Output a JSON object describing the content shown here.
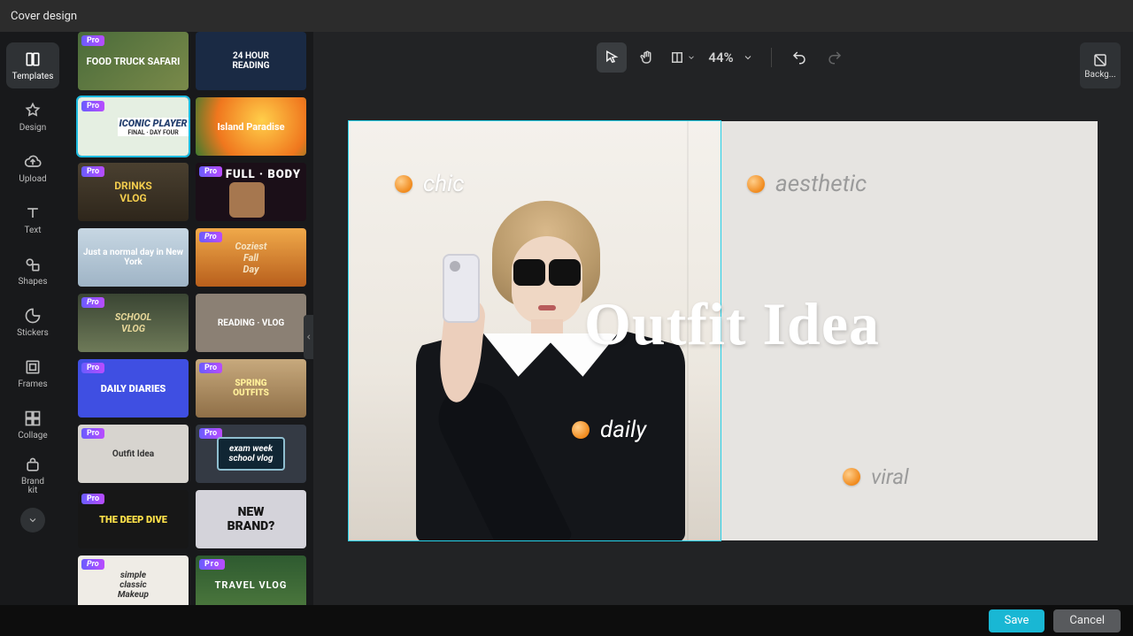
{
  "titlebar": {
    "title": "Cover design"
  },
  "sidebar": {
    "items": [
      {
        "label": "Templates"
      },
      {
        "label": "Design"
      },
      {
        "label": "Upload"
      },
      {
        "label": "Text"
      },
      {
        "label": "Shapes"
      },
      {
        "label": "Stickers"
      },
      {
        "label": "Frames"
      },
      {
        "label": "Collage"
      },
      {
        "label": "Brand\nkit"
      }
    ]
  },
  "templates": [
    {
      "pro": true,
      "text": "FOOD TRUCK SAFARI"
    },
    {
      "pro": false,
      "text": "24 HOUR\nREADING"
    },
    {
      "pro": true,
      "text": "ICONIC PLAYER",
      "sub": "FINAL · DAY FOUR",
      "selected": true
    },
    {
      "pro": false,
      "text": "Island Paradise"
    },
    {
      "pro": true,
      "text": "DRINKS\nVLOG"
    },
    {
      "pro": true,
      "text": "FULL · BODY"
    },
    {
      "pro": false,
      "text": "Just a normal day in New York"
    },
    {
      "pro": true,
      "text": "Coziest\nFall\nDay"
    },
    {
      "pro": true,
      "text": "SCHOOL\nVLOG"
    },
    {
      "pro": false,
      "text": "READING · VLOG"
    },
    {
      "pro": true,
      "text": "DAILY DIARIES"
    },
    {
      "pro": true,
      "text": "SPRING\nOUTFITS"
    },
    {
      "pro": true,
      "text": "Outfit Idea"
    },
    {
      "pro": true,
      "text": "exam week\nschool vlog"
    },
    {
      "pro": true,
      "text": "THE DEEP DIVE"
    },
    {
      "pro": false,
      "text": "NEW\nBRAND?"
    },
    {
      "pro": true,
      "text": "simple\nclassic\nMakeup"
    },
    {
      "pro": true,
      "text": "TRAVEL VLOG"
    }
  ],
  "toolbar": {
    "zoom": "44%"
  },
  "right_panel": {
    "label": "Backg..."
  },
  "canvas": {
    "title": "Outfit Idea",
    "tags": {
      "chic": "chic",
      "aesthetic": "aesthetic",
      "daily": "daily",
      "viral": "viral"
    },
    "accent_dot_color": "#f08a1d"
  },
  "footer": {
    "save": "Save",
    "cancel": "Cancel"
  }
}
